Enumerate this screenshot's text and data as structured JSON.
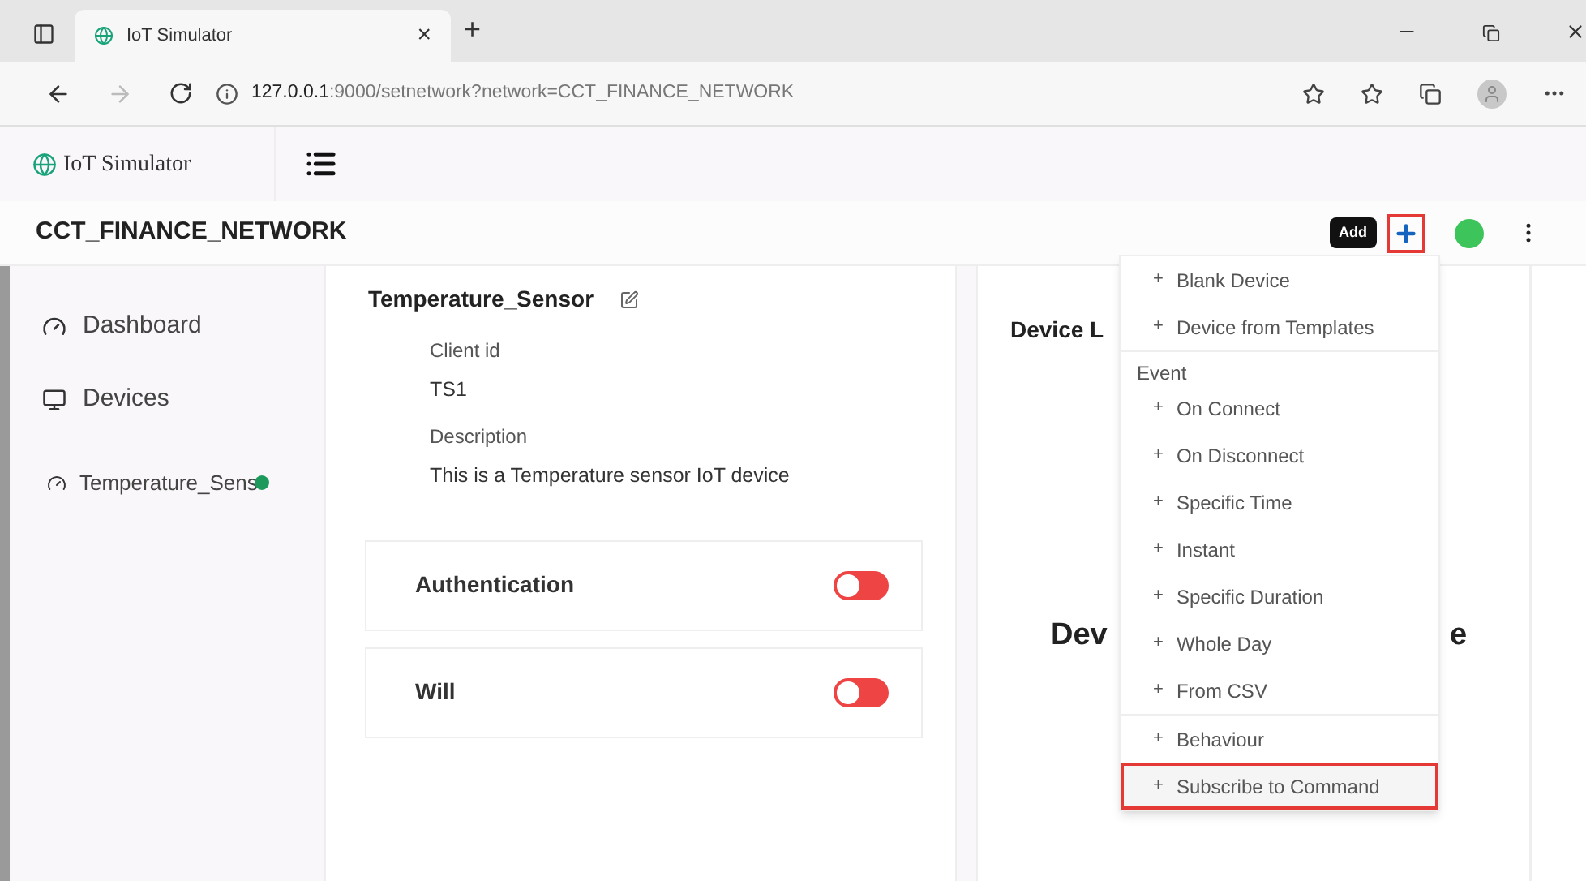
{
  "browser": {
    "tab_title": "IoT Simulator",
    "tab_close": "×",
    "new_tab": "+",
    "url_host": "127.0.0.1",
    "url_rest": ":9000/setnetwork?network=CCT_FINANCE_NETWORK"
  },
  "app": {
    "brand": "IoT Simulator"
  },
  "network": {
    "title": "CCT_FINANCE_NETWORK",
    "tooltip": "Add",
    "add_highlighted": true,
    "connected": true
  },
  "sidebar": {
    "items": [
      {
        "label": "Dashboard"
      },
      {
        "label": "Devices"
      }
    ],
    "devices": [
      {
        "label": "Temperature_Sens",
        "online": true
      }
    ]
  },
  "device": {
    "name": "Temperature_Sensor",
    "fields": [
      {
        "label": "Client id",
        "value": "TS1"
      },
      {
        "label": "Description",
        "value": "This is a Temperature sensor IoT device"
      }
    ],
    "toggles": [
      {
        "label": "Authentication",
        "on": false
      },
      {
        "label": "Will",
        "on": false
      }
    ]
  },
  "panel": {
    "title": "Device L",
    "center_left": "Dev",
    "center_right": "e"
  },
  "menu": [
    {
      "kind": "item",
      "label": "Blank Device",
      "highlighted": false
    },
    {
      "kind": "item",
      "label": "Device from Templates",
      "highlighted": false
    },
    {
      "kind": "divider"
    },
    {
      "kind": "header",
      "label": "Event"
    },
    {
      "kind": "item",
      "label": "On Connect",
      "highlighted": false
    },
    {
      "kind": "item",
      "label": "On Disconnect",
      "highlighted": false
    },
    {
      "kind": "item",
      "label": "Specific Time",
      "highlighted": false
    },
    {
      "kind": "item",
      "label": "Instant",
      "highlighted": false
    },
    {
      "kind": "item",
      "label": "Specific Duration",
      "highlighted": false
    },
    {
      "kind": "item",
      "label": "Whole Day",
      "highlighted": false
    },
    {
      "kind": "item",
      "label": "From CSV",
      "highlighted": false
    },
    {
      "kind": "divider"
    },
    {
      "kind": "item",
      "label": "Behaviour",
      "highlighted": false
    },
    {
      "kind": "item",
      "label": "Subscribe to Command",
      "highlighted": true
    }
  ],
  "menu_item_prefix": "+"
}
